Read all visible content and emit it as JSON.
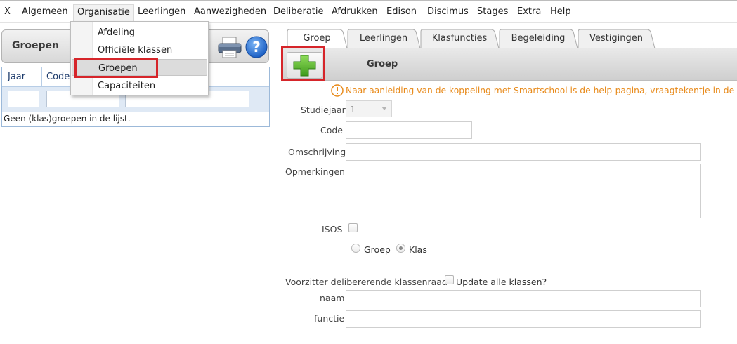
{
  "menu": {
    "items": [
      "X",
      "Algemeen",
      "Organisatie",
      "Leerlingen",
      "Aanwezigheden",
      "Deliberatie",
      "Afdrukken",
      "Edison",
      "Discimus",
      "Stages",
      "Extra",
      "Help"
    ],
    "active": "Organisatie"
  },
  "dropdown": {
    "items": [
      "Afdeling",
      "Officiële klassen",
      "Groepen",
      "Capaciteiten"
    ],
    "selected": "Groepen"
  },
  "left": {
    "title": "Groepen",
    "columns": [
      "Jaar",
      "Code"
    ],
    "empty_message": "Geen (klas)groepen in de lijst."
  },
  "tabs": {
    "items": [
      "Groep",
      "Leerlingen",
      "Klasfuncties",
      "Begeleiding",
      "Vestigingen"
    ],
    "active": "Groep"
  },
  "form": {
    "bar_title": "Groep",
    "notice": "Naar aanleiding van de koppeling met Smartschool is de help-pagina, vraagtekentje in de rech",
    "studiejaar_label": "Studiejaar",
    "studiejaar_value": "1",
    "code_label": "Code",
    "omschrijving_label": "Omschrijving",
    "opmerkingen_label": "Opmerkingen",
    "isos_label": "ISOS",
    "radio_groep": "Groep",
    "radio_klas": "Klas",
    "voorzitter_label": "Voorzitter delibererende klassenraad",
    "update_label": "Update alle klassen?",
    "naam_label": "naam",
    "functie_label": "functie"
  },
  "colors": {
    "highlight": "#d6252a",
    "notice": "#e88a1a",
    "add_green": "#5cb82e"
  }
}
